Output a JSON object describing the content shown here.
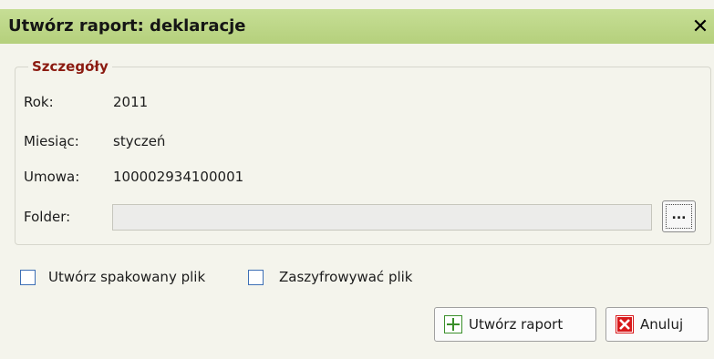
{
  "dialog": {
    "title": "Utwórz raport: deklaracje",
    "close_glyph": "✕"
  },
  "details": {
    "legend": "Szczegóły",
    "year_label": "Rok:",
    "year_value": "2011",
    "month_label": "Miesiąc:",
    "month_value": "styczeń",
    "contract_label": "Umowa:",
    "contract_value": "100002934100001",
    "folder_label": "Folder:",
    "folder_value": "",
    "browse_label": "..."
  },
  "options": {
    "packed_label": "Utwórz spakowany plik",
    "packed_checked": false,
    "encrypt_label": "Zaszyfrowywać plik",
    "encrypt_checked": false
  },
  "actions": {
    "create_label": "Utwórz raport",
    "create_icon": "plus-icon",
    "cancel_label": "Anuluj",
    "cancel_icon": "cancel-x-icon"
  },
  "colors": {
    "titlebar": "#bcd585",
    "legend": "#8b1a10",
    "dialog_bg": "#f4f4ec",
    "checkbox_border": "#3d6fb5"
  }
}
